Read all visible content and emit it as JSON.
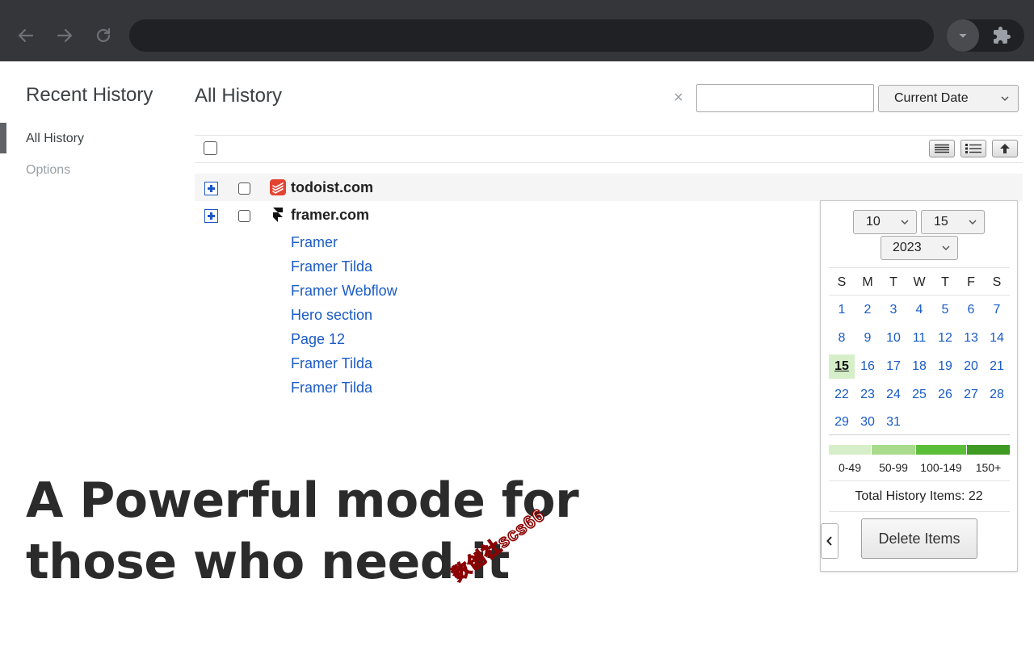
{
  "browser": {
    "colors": {
      "toolbar": "#35363a",
      "omnibox": "#202124"
    },
    "icons": [
      "back-arrow-icon",
      "forward-arrow-icon",
      "reload-icon",
      "dropdown-icon",
      "puzzle-icon"
    ]
  },
  "sidebar": {
    "title": "Recent History",
    "items": [
      {
        "label": "All History",
        "active": true
      },
      {
        "label": "Options",
        "active": false
      }
    ]
  },
  "header": {
    "title": "All History",
    "clear_glyph": "×",
    "search_value": "",
    "date_filter": "Current Date"
  },
  "toolbar": {
    "icons": [
      "compact-view-icon",
      "detail-view-icon",
      "scroll-top-icon"
    ]
  },
  "history": {
    "domains": [
      {
        "domain": "todoist.com",
        "favicon": "todoist-icon",
        "pages": []
      },
      {
        "domain": "framer.com",
        "favicon": "framer-icon",
        "pages": [
          "Framer",
          "Framer Tilda",
          "Framer Webflow",
          "Hero section",
          "Page 12",
          "Framer Tilda",
          "Framer Tilda"
        ]
      }
    ]
  },
  "headline": {
    "line1": "A Powerful mode for",
    "line2": "those who need it"
  },
  "watermark": "数创社scs66",
  "calendar": {
    "month": "10",
    "day": "15",
    "year": "2023",
    "weekdays": [
      "S",
      "M",
      "T",
      "W",
      "T",
      "F",
      "S"
    ],
    "weeks": [
      [
        "1",
        "2",
        "3",
        "4",
        "5",
        "6",
        "7"
      ],
      [
        "8",
        "9",
        "10",
        "11",
        "12",
        "13",
        "14"
      ],
      [
        "15",
        "16",
        "17",
        "18",
        "19",
        "20",
        "21"
      ],
      [
        "22",
        "23",
        "24",
        "25",
        "26",
        "27",
        "28"
      ],
      [
        "29",
        "30",
        "31"
      ]
    ],
    "today": "15",
    "legend": [
      {
        "label": "0-49",
        "color": "#d6efc9"
      },
      {
        "label": "50-99",
        "color": "#a8db8c"
      },
      {
        "label": "100-149",
        "color": "#5cbf3a"
      },
      {
        "label": "150+",
        "color": "#3f9a22"
      }
    ],
    "total_label": "Total History Items: 22",
    "delete_label": "Delete Items"
  }
}
